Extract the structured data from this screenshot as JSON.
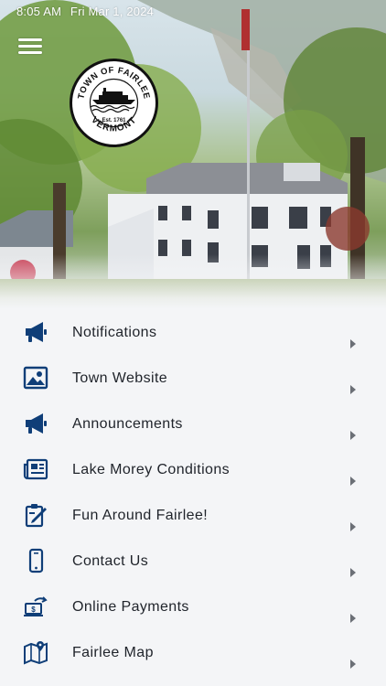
{
  "status_bar": {
    "time": "8:05 AM",
    "date": "Fri Mar 1, 2024"
  },
  "seal": {
    "top_text": "TOWN OF FAIRLEE",
    "established": "Est. 1761",
    "bottom_text": "VERMONT"
  },
  "colors": {
    "icon": "#0f3e78",
    "chevron": "#6b6f76",
    "text": "#1f232a",
    "background": "#f4f5f7"
  },
  "menu": [
    {
      "label": "Notifications",
      "icon": "megaphone-icon"
    },
    {
      "label": "Town Website",
      "icon": "picture-icon"
    },
    {
      "label": "Announcements",
      "icon": "megaphone-icon"
    },
    {
      "label": "Lake Morey Conditions",
      "icon": "newspaper-icon"
    },
    {
      "label": "Fun Around Fairlee!",
      "icon": "clipboard-edit-icon"
    },
    {
      "label": "Contact Us",
      "icon": "phone-icon"
    },
    {
      "label": "Online Payments",
      "icon": "payment-icon"
    },
    {
      "label": "Fairlee Map",
      "icon": "map-icon"
    }
  ]
}
